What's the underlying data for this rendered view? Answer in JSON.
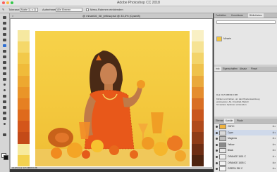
{
  "app": {
    "title": "Adobe Photoshop CC 2018"
  },
  "options_bar": {
    "tolerance_label": "Toleranz:",
    "tolerance_value": "Matte 11 x 11",
    "sample_label": "Aufnehmen:",
    "sample_value": "Alle Ebenen",
    "ring_label": "Mess-Rahmen einblenden"
  },
  "document": {
    "tab_title": "@ minari16_08_yellow.psd @ 33,3% (Cyan/8)",
    "status": "33,33%   Dok: 93,5 MB/93,5 MB"
  },
  "swatches": {
    "left": [
      "#f6e8a0",
      "#f5d86a",
      "#f2c94a",
      "#f0bb3a",
      "#eda830",
      "#ea9528",
      "#e68022",
      "#df6a1c",
      "#d4561a",
      "#c44a18",
      "#f7ea9e",
      "#f3d250"
    ],
    "right": [
      "#f9f0c4",
      "#f6e394",
      "#f3d46a",
      "#efc24c",
      "#eaa93c",
      "#e58d2e",
      "#d96f24",
      "#c9561e",
      "#b04a1c",
      "#8f3c18",
      "#6e2e14",
      "#4f2410"
    ]
  },
  "panels": {
    "top_tabs": [
      "Farbfelder",
      "Korrekturen",
      "Bibliotheken"
    ],
    "library": {
      "item": "Minarie"
    },
    "mid_tabs": [
      "Info",
      "Eigenschaften",
      "Absatz",
      "Pinsel"
    ],
    "info_lines": [
      "Dok: 93,5 MB/93,5 MB",
      "Klicken und ziehen, um das Pipettenwerkzeug",
      "einzusetzen. Alt, Umschalt, Befehl",
      "für weitere Optionen verwenden."
    ],
    "channel_tabs": [
      "Ebenen",
      "Kanäle",
      "Pfade"
    ],
    "channels": [
      {
        "name": "CMYK",
        "key": "⌘2",
        "color": "#f1b33d"
      },
      {
        "name": "Cyan",
        "key": "⌘3",
        "color": "#d9d9d9"
      },
      {
        "name": "Magenta",
        "key": "⌘4",
        "color": "#bdbdbd"
      },
      {
        "name": "Yellow",
        "key": "⌘5",
        "color": "#8a8a8a"
      },
      {
        "name": "Black",
        "key": "⌘6",
        "color": "#e7e7e7"
      },
      {
        "name": "ORANGE 1501 C",
        "key": "⌘7",
        "color": "#efefef"
      },
      {
        "name": "ORANGE 1505 C",
        "key": "⌘8",
        "color": "#f3f3f3"
      },
      {
        "name": "GREEN 350 C",
        "key": "⌘9",
        "color": "#f6f6f6"
      }
    ]
  }
}
